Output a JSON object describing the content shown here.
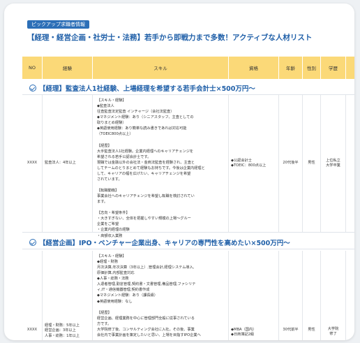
{
  "badge": "ピックアップ求職者情報",
  "title": "【経理・経営企画・社労士・法務】若手から即戦力まで多数！アクティブな人材リスト",
  "columns": [
    "NO",
    "経験",
    "スキル",
    "資格",
    "年齢",
    "性別",
    "学歴"
  ],
  "sections": [
    {
      "heading": "【経理】監査法人1社経験、上場経理を希望する若手会計士×500万円〜",
      "row": {
        "no": "XXXX",
        "experience": "監査法人：4年以上",
        "skills": "【スキル・経験】\n◆監査法人\n往査監査法定監査 インチャージ（会社法監査）\n◆マネジメント経験：あり（シニアスタッフ、主査としての\n取りまとめ経験）\n◆英語使用経験：あり簡単な読み書きであれば対応可能\n（TOEIC800点以上）\n\n【経歴】\n大手監査法人1社経験。企業内経理へのキャリアチェンジを\n希望される若手公認会計士です。\n現職では金融以外の会社法・金商法監査を経験され、主査と\nしてチームのとりまとめて経験もお持ちです。今後は企業内経理と\nして、キャリアの幅を広げたい、キャリアチェンジを希望\nされています。\n\n【転職動機】\n事業会社へのキャリアチェンジを希望し転職を検討されてい\nます。\n\n【志向・希望条件】\n・大きすぎない、全体を把握しやすい規模の上場〜グルー\n企業をご希望\n・企業内経理の経験\n・高額収入業務",
        "qualification": "◆公認会計士\n◆TOEIC：800点以上",
        "age": "20代後半",
        "gender": "男性",
        "education": "上位私立\n大学卒業"
      }
    },
    {
      "heading": "【経営企画】IPO・ベンチャー企業出身、キャリアの専門性を高めたい×500万円〜",
      "row": {
        "no": "XXXX",
        "experience": "経理・財務：5年以上\n経営企画：3年以上\n人事・総務：1年以上",
        "skills": "【スキル・経験】\n◆経理・財務\n月次決算,年次決算（3年以上）,管理会計,経理システム導入,\n原価計算,内部監査対応\n◆人事・総務・法務\n入退者管理,勤怠管理,契約書・文書管理,備品管理,ファシリテ\nィ,IT・通信機器管理,契約書作成\n◆マネジメント経験：あり（課長級）\n◆英語使用経験：なし\n\n【経歴】\n経営企画、経理業務を中心に管理部門全般に従事されている\n方です。\n大学院修了後、コンサルティング会社に入社。その後、事業\n会社内で事業計画を策定したいと思い、上場を目指すIPO企業へ",
        "qualification": "◆MBA（国内）\n◆日商簿記2級",
        "age": "30代前半",
        "gender": "男性",
        "education": "大学院\n修了"
      }
    }
  ]
}
